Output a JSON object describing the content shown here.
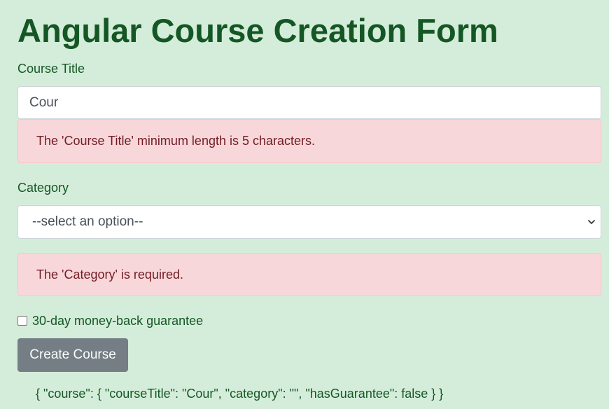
{
  "page": {
    "title": "Angular Course Creation Form"
  },
  "form": {
    "course_title": {
      "label": "Course Title",
      "value": "Cour",
      "error": "The 'Course Title' minimum length is 5 characters."
    },
    "category": {
      "label": "Category",
      "selected": "--select an option--",
      "error": "The 'Category' is required."
    },
    "guarantee": {
      "label": "30-day money-back guarantee",
      "checked": false
    },
    "submit_label": "Create Course"
  },
  "debug_output": "{ \"course\": { \"courseTitle\": \"Cour\", \"category\": \"\", \"hasGuarantee\": false } }",
  "colors": {
    "background": "#d4edda",
    "text": "#155724",
    "alert_bg": "#f8d7da",
    "alert_text": "#721c24",
    "button_bg": "#6c757d"
  }
}
